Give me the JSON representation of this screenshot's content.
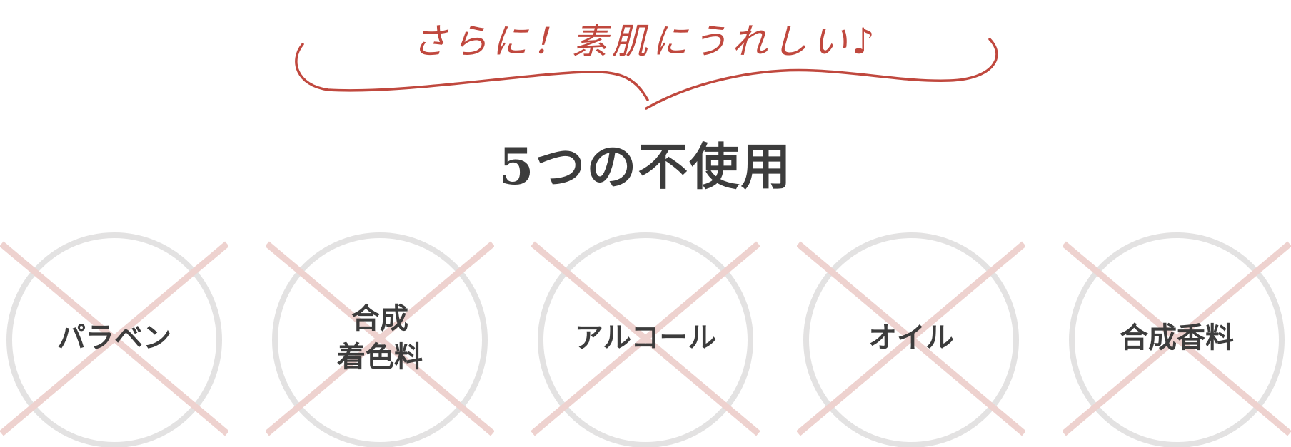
{
  "tagline": "さらに！素肌にうれしい♪",
  "heading": "5つの不使用",
  "items": [
    {
      "label": "パラベン"
    },
    {
      "label": "合成\n着色料"
    },
    {
      "label": "アルコール"
    },
    {
      "label": "オイル"
    },
    {
      "label": "合成香料"
    }
  ],
  "colors": {
    "accent": "#c0483e",
    "text": "#3c3c3c",
    "circle": "#e3e2e2",
    "cross": "#eed2cf"
  }
}
